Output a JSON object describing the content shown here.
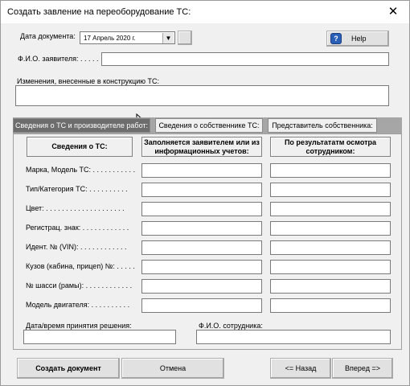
{
  "window": {
    "title": "Создать завление на переоборудование ТС:",
    "close_glyph": "✕"
  },
  "header": {
    "date_label": "Дата документа:",
    "date_value": "17 Апрель 2020 г.",
    "help_label": "Help",
    "applicant_label": "Ф.И.О. заявителя: . . . . .",
    "changes_label": "Изменения, внесенные в конструкцию ТС:"
  },
  "tabs": [
    {
      "label": "Сведения о ТС и производителе работ:",
      "active": true
    },
    {
      "label": "Сведения о собственнике ТС:",
      "active": false
    },
    {
      "label": "Представитель собственника:",
      "active": false
    }
  ],
  "table": {
    "col1_header": "Сведения о ТС:",
    "col2_header": "Заполняется заявителем или из информационных учетов:",
    "col3_header": "По результататм осмотра сотрудником:",
    "rows": [
      "Марка, Модель ТС: . . . . . . . . . . .",
      "Тип/Категория  ТС: . . . . . . . . . .",
      "Цвет: . . . . . . . . . . . . . . . . . . . .",
      "Регистрац. знак: . . . . . . . . . . . .",
      "Идент. № (VIN): . . . . . . . . . . . .",
      "Кузов (кабина, прицеп) №: . . . . .",
      "№ шасси (рамы): . . . . . . . . . . . .",
      "Модель двигателя: . . . . . . . . . ."
    ]
  },
  "footer_fields": {
    "decision_label": "Дата/время принятия решения:",
    "employee_label": "Ф.И.О. сотрудника:"
  },
  "buttons": {
    "create": "Создать документ",
    "cancel": "Отмена",
    "back": "<= Назад",
    "forward": "Вперед =>"
  },
  "colors": {
    "active_tab": "#6d6d6d",
    "help_icon": "#2a5fb8"
  },
  "icons": {
    "help": "help-icon",
    "dropdown": "chevron-down-icon",
    "close": "close-icon"
  }
}
